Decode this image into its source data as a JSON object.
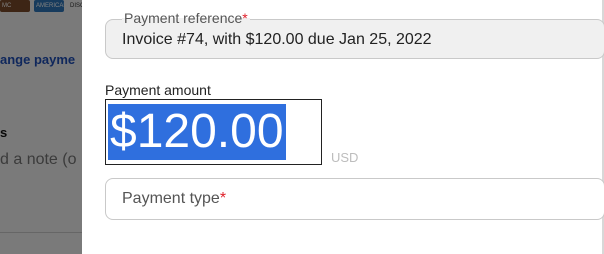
{
  "background": {
    "cards": [
      "MC",
      "AMERICAN EXPRESS",
      "DISCOVER"
    ],
    "change_payment_link": "ange payme",
    "section_heading": "s",
    "note_placeholder": "d a note (o"
  },
  "modal": {
    "payment_reference": {
      "label": "Payment reference",
      "required_mark": "*",
      "value": "Invoice #74, with $120.00 due Jan 25, 2022"
    },
    "payment_amount": {
      "label": "Payment amount",
      "value": "$120.00",
      "currency": "USD"
    },
    "payment_type": {
      "label": "Payment type",
      "required_mark": "*"
    }
  },
  "colors": {
    "selection": "#2f6fde",
    "required": "#e0202a",
    "link": "#1f4fb8"
  }
}
